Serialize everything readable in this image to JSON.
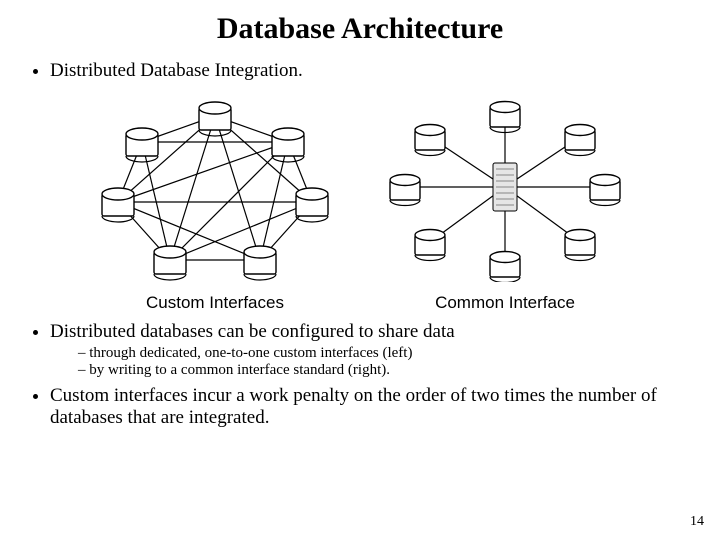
{
  "title": "Database Architecture",
  "bullets": {
    "b1": "Distributed Database Integration.",
    "b2": "Distributed databases can be configured to share data",
    "b2_sub1": "through dedicated, one-to-one custom interfaces (left)",
    "b2_sub2": "by writing to a common interface standard (right).",
    "b3": "Custom interfaces incur a work penalty on the order of two times the number of databases that are integrated."
  },
  "figures": {
    "left_caption": "Custom Interfaces",
    "right_caption": "Common Interface"
  },
  "page_number": "14"
}
